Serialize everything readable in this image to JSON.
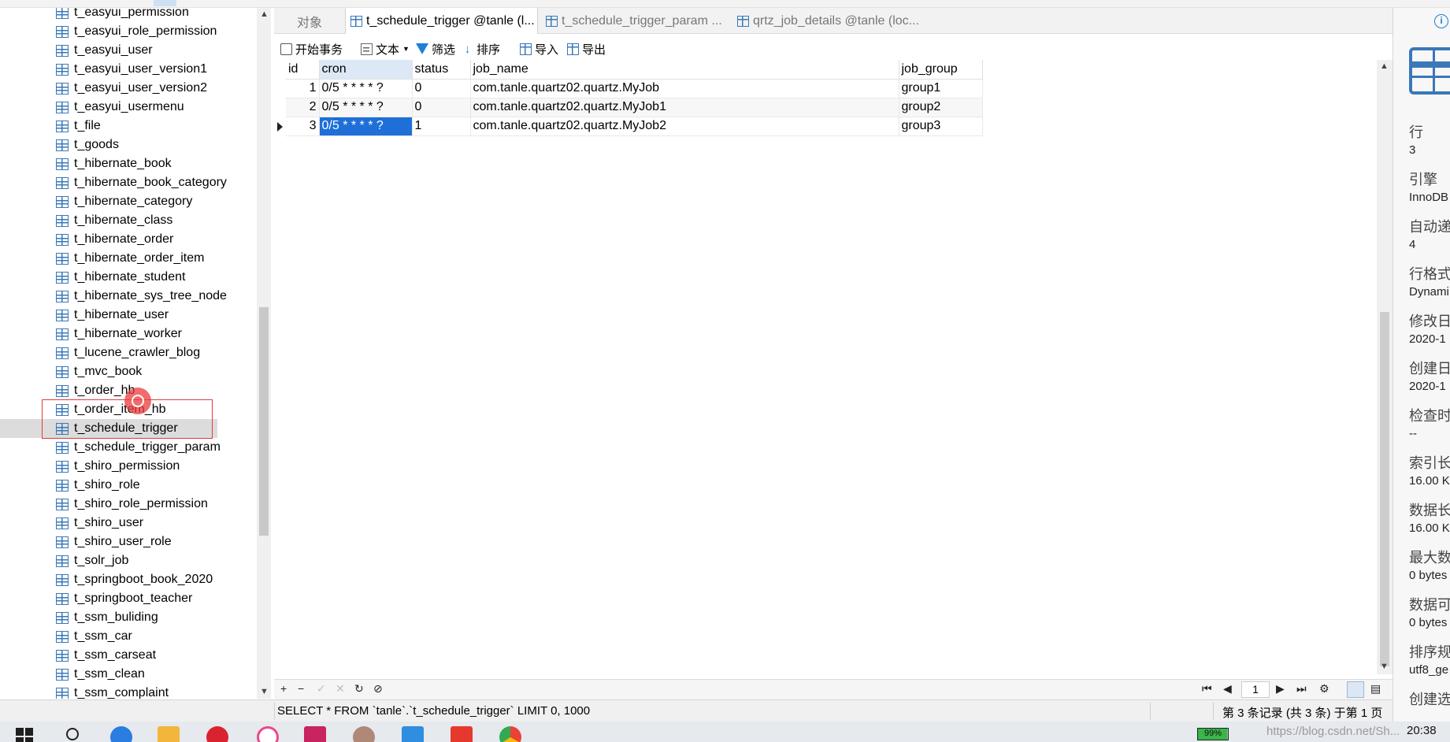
{
  "tree": {
    "items": [
      "t_easyui_permission",
      "t_easyui_role_permission",
      "t_easyui_user",
      "t_easyui_user_version1",
      "t_easyui_user_version2",
      "t_easyui_usermenu",
      "t_file",
      "t_goods",
      "t_hibernate_book",
      "t_hibernate_book_category",
      "t_hibernate_category",
      "t_hibernate_class",
      "t_hibernate_order",
      "t_hibernate_order_item",
      "t_hibernate_student",
      "t_hibernate_sys_tree_node",
      "t_hibernate_user",
      "t_hibernate_worker",
      "t_lucene_crawler_blog",
      "t_mvc_book",
      "t_order_hb",
      "t_order_item_hb",
      "t_schedule_trigger",
      "t_schedule_trigger_param",
      "t_shiro_permission",
      "t_shiro_role",
      "t_shiro_role_permission",
      "t_shiro_user",
      "t_shiro_user_role",
      "t_solr_job",
      "t_springboot_book_2020",
      "t_springboot_teacher",
      "t_ssm_buliding",
      "t_ssm_car",
      "t_ssm_carseat",
      "t_ssm_clean",
      "t_ssm_complaint"
    ],
    "selected_index": 22
  },
  "tabs": {
    "objects": "对象",
    "tab1": "t_schedule_trigger @tanle (l...",
    "tab2": "t_schedule_trigger_param ...",
    "tab3": "qrtz_job_details @tanle (loc..."
  },
  "toolbar": {
    "begin_txn": "开始事务",
    "text": "文本",
    "filter": "筛选",
    "sort": "排序",
    "import": "导入",
    "export": "导出"
  },
  "grid": {
    "columns": [
      "id",
      "cron",
      "status",
      "job_name",
      "job_group"
    ],
    "rows": [
      [
        "1",
        "0/5 * * * * ?",
        "0",
        "com.tanle.quartz02.quartz.MyJob",
        "group1"
      ],
      [
        "2",
        "0/5 * * * * ?",
        "0",
        "com.tanle.quartz02.quartz.MyJob1",
        "group2"
      ],
      [
        "3",
        "0/5 * * * * ?",
        "1",
        "com.tanle.quartz02.quartz.MyJob2",
        "group3"
      ]
    ]
  },
  "bottom": {
    "add": "+",
    "remove": "−",
    "apply": "✓",
    "cancel": "✕",
    "refresh": "↻",
    "stop": "⊘",
    "first": "⏮",
    "prev": "◀",
    "page": "1",
    "next": "▶",
    "last": "⏭",
    "settings": "⚙"
  },
  "status": {
    "sql": "SELECT * FROM `tanle`.`t_schedule_trigger` LIMIT 0, 1000",
    "records": "第 3 条记录 (共 3 条) 于第 1 页"
  },
  "info": {
    "items": [
      {
        "label": "行",
        "value": "3"
      },
      {
        "label": "引擎",
        "value": "InnoDB"
      },
      {
        "label": "自动递",
        "value": "4"
      },
      {
        "label": "行格式",
        "value": "Dynami"
      },
      {
        "label": "修改日",
        "value": "2020-1"
      },
      {
        "label": "创建日",
        "value": "2020-1"
      },
      {
        "label": "检查时",
        "value": "--"
      },
      {
        "label": "索引长",
        "value": "16.00 K"
      },
      {
        "label": "数据长",
        "value": "16.00 K"
      },
      {
        "label": "最大数",
        "value": "0 bytes"
      },
      {
        "label": "数据可",
        "value": "0 bytes"
      },
      {
        "label": "排序规",
        "value": "utf8_ge"
      },
      {
        "label": "创建选",
        "value": ""
      }
    ]
  },
  "taskbar": {
    "battery": "99%",
    "clock": "20:38",
    "watermark": "https://blog.csdn.net/Sh..."
  },
  "colors": {
    "selection": "#1e6fd8",
    "accent": "#3a78b8",
    "highlight_box": "#e23b3b"
  }
}
